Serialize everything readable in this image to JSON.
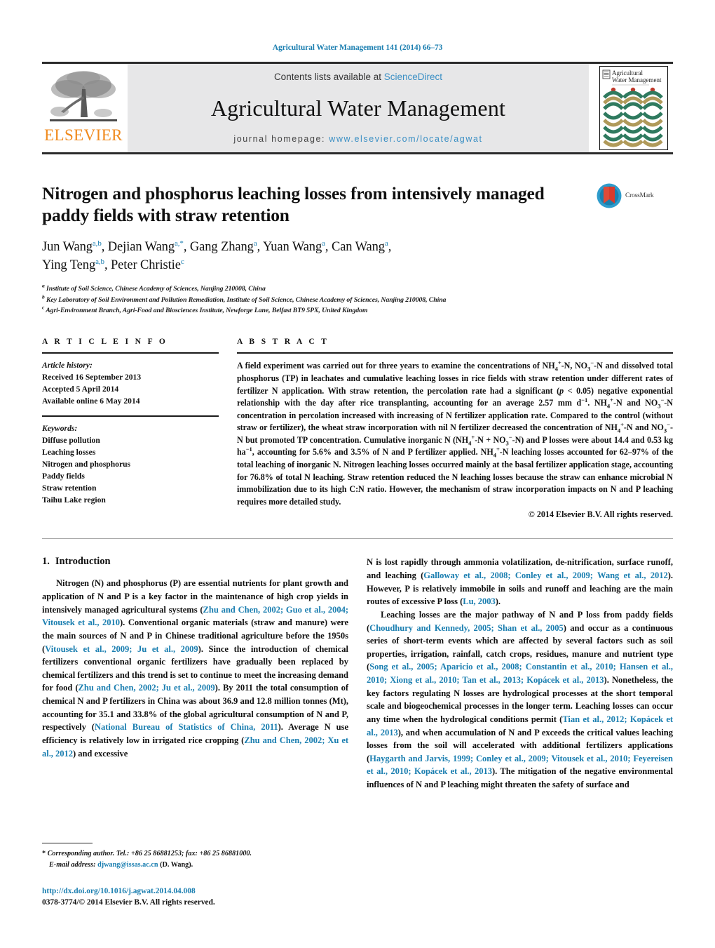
{
  "header": {
    "running_head": "Agricultural Water Management 141 (2014) 66–73",
    "contents_prefix": "Contents lists available at ",
    "contents_link": "ScienceDirect",
    "journal_title": "Agricultural Water Management",
    "homepage_prefix": "journal homepage: ",
    "homepage_url": "www.elsevier.com/locate/agwat",
    "publisher_wordmark": "ELSEVIER",
    "cover_title_line1": "Agricultural",
    "cover_title_line2": "Water Management",
    "colors": {
      "link": "#1a7eb0",
      "science_direct": "#3a8fc4",
      "elsevier_orange": "#f08a1d",
      "band_gray": "#e7e7e8",
      "cover_green": "#2f7a5f",
      "cover_tan": "#b09a5a",
      "cover_red": "#c0392b"
    }
  },
  "article": {
    "title": "Nitrogen and phosphorus leaching losses from intensively managed paddy fields with straw retention",
    "crossmark_label": "CrossMark",
    "authors_line1": [
      {
        "name": "Jun Wang",
        "sup": "a,b"
      },
      {
        "name": "Dejian Wang",
        "sup": "a,*"
      },
      {
        "name": "Gang Zhang",
        "sup": "a"
      },
      {
        "name": "Yuan Wang",
        "sup": "a"
      },
      {
        "name": "Can Wang",
        "sup": "a"
      }
    ],
    "authors_line2": [
      {
        "name": "Ying Teng",
        "sup": "a,b"
      },
      {
        "name": "Peter Christie",
        "sup": "c"
      }
    ],
    "affiliations": [
      {
        "marker": "a",
        "text": "Institute of Soil Science, Chinese Academy of Sciences, Nanjing 210008, China"
      },
      {
        "marker": "b",
        "text": "Key Laboratory of Soil Environment and Pollution Remediation, Institute of Soil Science, Chinese Academy of Sciences, Nanjing 210008, China"
      },
      {
        "marker": "c",
        "text": "Agri-Environment Branch, Agri-Food and Biosciences Institute, Newforge Lane, Belfast BT9 5PX, United Kingdom"
      }
    ]
  },
  "article_info": {
    "heading": "A R T I C L E   I N F O",
    "history_label": "Article history:",
    "history": [
      "Received 16 September 2013",
      "Accepted 5 April 2014",
      "Available online 6 May 2014"
    ],
    "keywords_label": "Keywords:",
    "keywords": [
      "Diffuse pollution",
      "Leaching losses",
      "Nitrogen and phosphorus",
      "Paddy fields",
      "Straw retention",
      "Taihu Lake region"
    ]
  },
  "abstract": {
    "heading": "A B S T R A C T",
    "copyright": "© 2014 Elsevier B.V. All rights reserved."
  },
  "introduction": {
    "section_number": "1.",
    "section_title": "Introduction"
  },
  "footnote": {
    "corresponding": "Corresponding author. Tel.: +86 25 86881253; fax: +86 25 86881000.",
    "email_label": "E-mail address:",
    "email": "djwang@issas.ac.cn",
    "email_suffix": "(D. Wang)."
  },
  "doi": {
    "url": "http://dx.doi.org/10.1016/j.agwat.2014.04.008",
    "issn_line": "0378-3774/© 2014 Elsevier B.V. All rights reserved."
  }
}
